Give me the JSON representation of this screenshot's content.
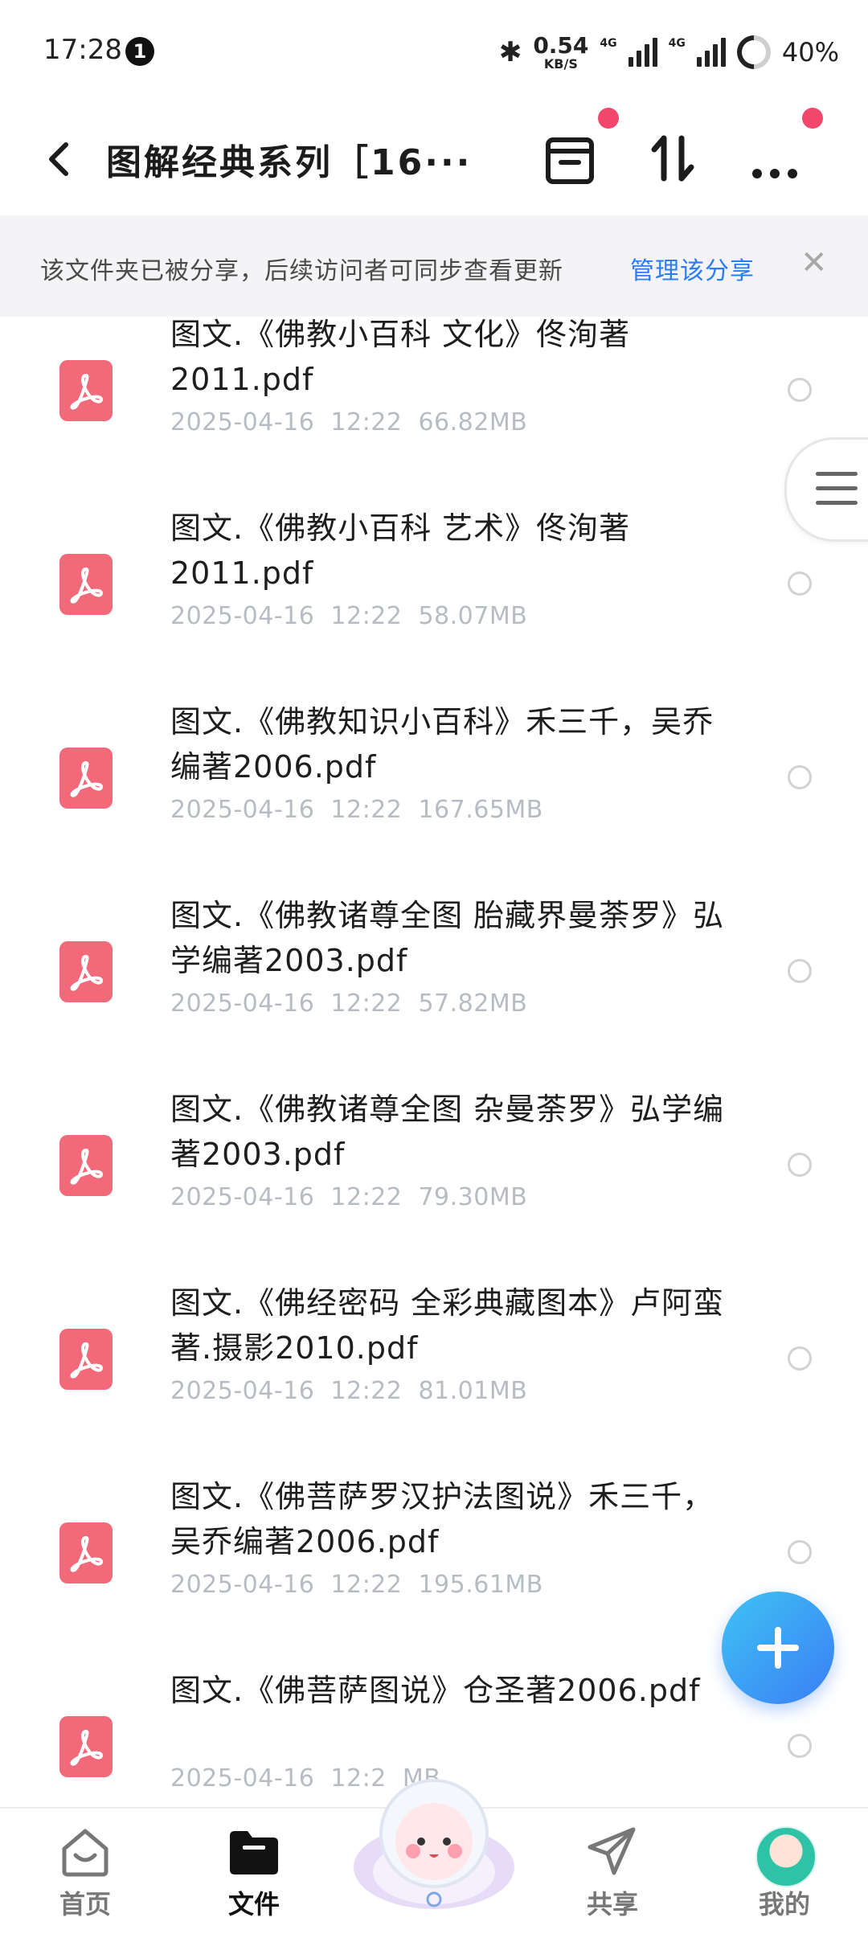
{
  "status_bar": {
    "time": "17:28",
    "notification_count": "1",
    "speed_value": "0.54",
    "speed_unit": "KB/S",
    "net1": "4G",
    "net2": "4G",
    "battery": "40%"
  },
  "header": {
    "title": "图解经典系列［16···"
  },
  "notice": {
    "text": "该文件夹已被分享，后续访问者可同步查看更新",
    "link": "管理该分享",
    "close": "✕"
  },
  "files": [
    {
      "name": "图文.《佛教小百科 文化》佟洵著2011.pdf",
      "date": "2025-04-16",
      "time": "12:22",
      "size": "66.82MB"
    },
    {
      "name": "图文.《佛教小百科 艺术》佟洵著2011.pdf",
      "date": "2025-04-16",
      "time": "12:22",
      "size": "58.07MB"
    },
    {
      "name": "图文.《佛教知识小百科》禾三千，吴乔编著2006.pdf",
      "date": "2025-04-16",
      "time": "12:22",
      "size": "167.65MB"
    },
    {
      "name": "图文.《佛教诸尊全图 胎藏界曼荼罗》弘学编著2003.pdf",
      "date": "2025-04-16",
      "time": "12:22",
      "size": "57.82MB"
    },
    {
      "name": "图文.《佛教诸尊全图 杂曼荼罗》弘学编著2003.pdf",
      "date": "2025-04-16",
      "time": "12:22",
      "size": "79.30MB"
    },
    {
      "name": "图文.《佛经密码 全彩典藏图本》卢阿蛮著.摄影2010.pdf",
      "date": "2025-04-16",
      "time": "12:22",
      "size": "81.01MB"
    },
    {
      "name": "图文.《佛菩萨罗汉护法图说》禾三千，吴乔编著2006.pdf",
      "date": "2025-04-16",
      "time": "12:22",
      "size": "195.61MB"
    },
    {
      "name": "图文.《佛菩萨图说》仓圣著2006.pdf",
      "date": "2025-04-16",
      "time": "12:2",
      "size": "MB"
    }
  ],
  "nav": {
    "home": "首页",
    "files": "文件",
    "share": "共享",
    "mine": "我的"
  },
  "colors": {
    "accent": "#2b7cf6",
    "pdf_icon": "#f2697a",
    "badge_dot": "#f2476a",
    "notice_bg": "#f4f4f6"
  },
  "icons": {
    "back": "chevron-left-icon",
    "recycle": "archive-icon",
    "sort": "sort-icon",
    "more": "more-icon",
    "file_type": "pdf-icon",
    "fab": "plus-icon"
  }
}
